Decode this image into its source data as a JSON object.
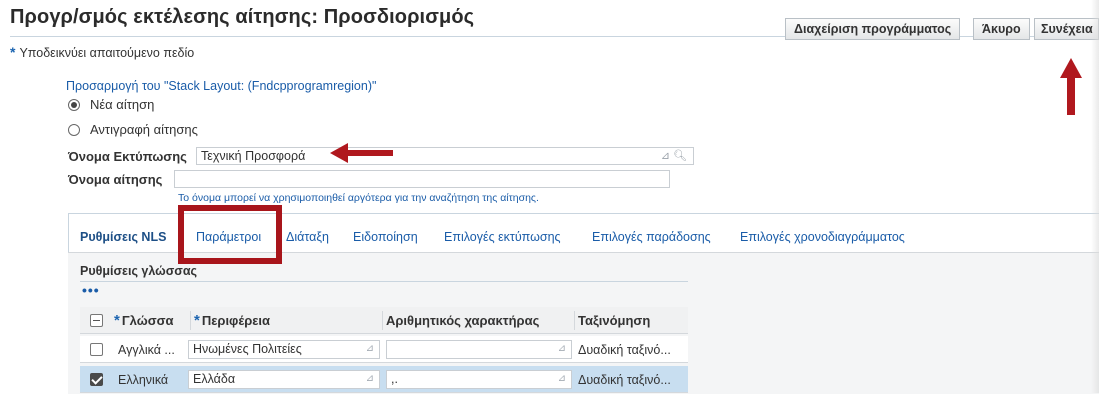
{
  "header": {
    "title": "Προγρ/σμός εκτέλεσης αίτησης: Προσδιορισμός",
    "buttons": {
      "schedule": "Διαχείριση προγράμματος",
      "cancel": "Άκυρο",
      "continue": "Συνέχεια"
    }
  },
  "required_note": {
    "star": "*",
    "text": "Υποδεικνύει απαιτούμενο πεδίο"
  },
  "personalize_link": "Προσαρμογή του \"Stack Layout: (Fndcpprogramregion)\"",
  "request_type": {
    "options": [
      {
        "label": "Νέα αίτηση",
        "selected": true
      },
      {
        "label": "Αντιγραφή αίτησης",
        "selected": false
      }
    ]
  },
  "form": {
    "print_name_label": "Όνομα Εκτύπωσης",
    "print_name_value": "Τεχνική Προσφορά",
    "request_name_label": "Όνομα αίτησης",
    "request_name_value": "",
    "request_name_hint": "Το όνομα μπορεί να χρησιμοποιηθεί αργότερα για την αναζήτηση της αίτησης."
  },
  "tabs": [
    {
      "label": "Ρυθμίσεις NLS",
      "active": true
    },
    {
      "label": "Παράμετροι",
      "active": false
    },
    {
      "label": "Διάταξη",
      "active": false
    },
    {
      "label": "Ειδοποίηση",
      "active": false
    },
    {
      "label": "Επιλογές εκτύπωσης",
      "active": false
    },
    {
      "label": "Επιλογές παράδοσης",
      "active": false
    },
    {
      "label": "Επιλογές χρονοδιαγράμματος",
      "active": false
    }
  ],
  "language_section": {
    "title": "Ρυθμίσεις γλώσσας",
    "more_icon": "•••",
    "columns": {
      "language": "Γλώσσα",
      "territory": "Περιφέρεια",
      "numeric_char": "Αριθμητικός χαρακτήρας",
      "sort": "Ταξινόμηση"
    },
    "rows": [
      {
        "checked": false,
        "language": "Αγγλικά ...",
        "territory": "Ηνωμένες Πολιτείες",
        "numeric_char": "",
        "sort": "Δυαδική ταξινό..."
      },
      {
        "checked": true,
        "language": "Ελληνικά",
        "territory": "Ελλάδα",
        "numeric_char": ",.",
        "sort": "Δυαδική ταξινό..."
      }
    ]
  },
  "colors": {
    "annotation_red": "#b0181e",
    "link_blue": "#1a5ca8",
    "selected_row": "#c8def0"
  }
}
